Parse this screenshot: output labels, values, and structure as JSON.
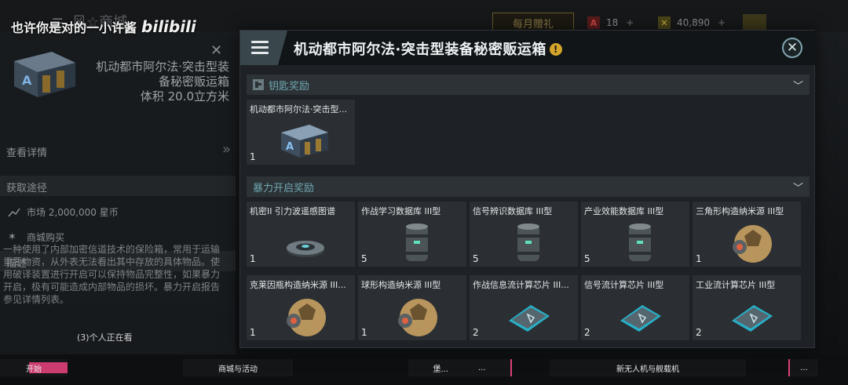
{
  "watermark": {
    "text": "也许你是对的一小许酱",
    "logo": "bilibili"
  },
  "background": {
    "menu_icon": "menu-icon",
    "shop_title": "风☆商城",
    "monthly_gift": "每月赠礼",
    "currency1": {
      "value": "18",
      "plus": "+",
      "icon": "red-a-icon",
      "color": "#c44"
    },
    "currency2": {
      "value": "40,890",
      "plus": "+",
      "icon": "yellow-x-icon",
      "color": "#c9b43a"
    }
  },
  "left_panel": {
    "item_name": "机动都市阿尔法·突击型装备秘密贩运箱",
    "volume_label": "体积",
    "volume_value": "20.0立方米",
    "view_details": "查看详情",
    "acquire_heading": "获取途径",
    "acquire": [
      {
        "label": "市场 2,000,000 星币",
        "icon": "market-icon"
      },
      {
        "label": "商城购买",
        "icon": "shop-icon"
      }
    ],
    "desc_heading": "描述",
    "description": "一种使用了内部加密信道技术的保险箱，常用于运输重要物资，从外表无法看出其中存放的具体物品。使用破译装置进行开启可以保持物品完整性，如果暴力开启，极有可能造成内部物品的损坏。暴力开启报告参见详情列表。"
  },
  "watching": "(3)个人正在看",
  "bottom_tabs": [
    "开始",
    "商城与活动",
    "堡...",
    "...",
    "新无人机与舰载机",
    "..."
  ],
  "modal": {
    "title": "机动都市阿尔法·突击型装备秘密贩运箱",
    "key_group": {
      "label": "钥匙奖励",
      "items": [
        {
          "name": "机动都市阿尔法·突击型...",
          "count": "1",
          "icon": "crate-icon"
        }
      ]
    },
    "force_group": {
      "label": "暴力开启奖励",
      "items": [
        {
          "name": "机密II 引力波遥感图谱",
          "count": "1",
          "icon": "disc-icon"
        },
        {
          "name": "作战学习数据库 III型",
          "count": "5",
          "icon": "canister-icon"
        },
        {
          "name": "信号辨识数据库 III型",
          "count": "5",
          "icon": "canister-icon"
        },
        {
          "name": "产业效能数据库 III型",
          "count": "5",
          "icon": "canister-icon"
        },
        {
          "name": "三角形构造纳米源 III型",
          "count": "1",
          "icon": "sphere-icon"
        },
        {
          "name": "克莱因瓶构造纳米源 III...",
          "count": "1",
          "icon": "sphere-icon"
        },
        {
          "name": "球形构造纳米源 III型",
          "count": "1",
          "icon": "sphere-icon"
        },
        {
          "name": "作战信息流计算芯片 III...",
          "count": "2",
          "icon": "chip-icon"
        },
        {
          "name": "信号流计算芯片 III型",
          "count": "2",
          "icon": "chip-icon"
        },
        {
          "name": "工业流计算芯片 III型",
          "count": "2",
          "icon": "chip-icon"
        }
      ]
    }
  }
}
